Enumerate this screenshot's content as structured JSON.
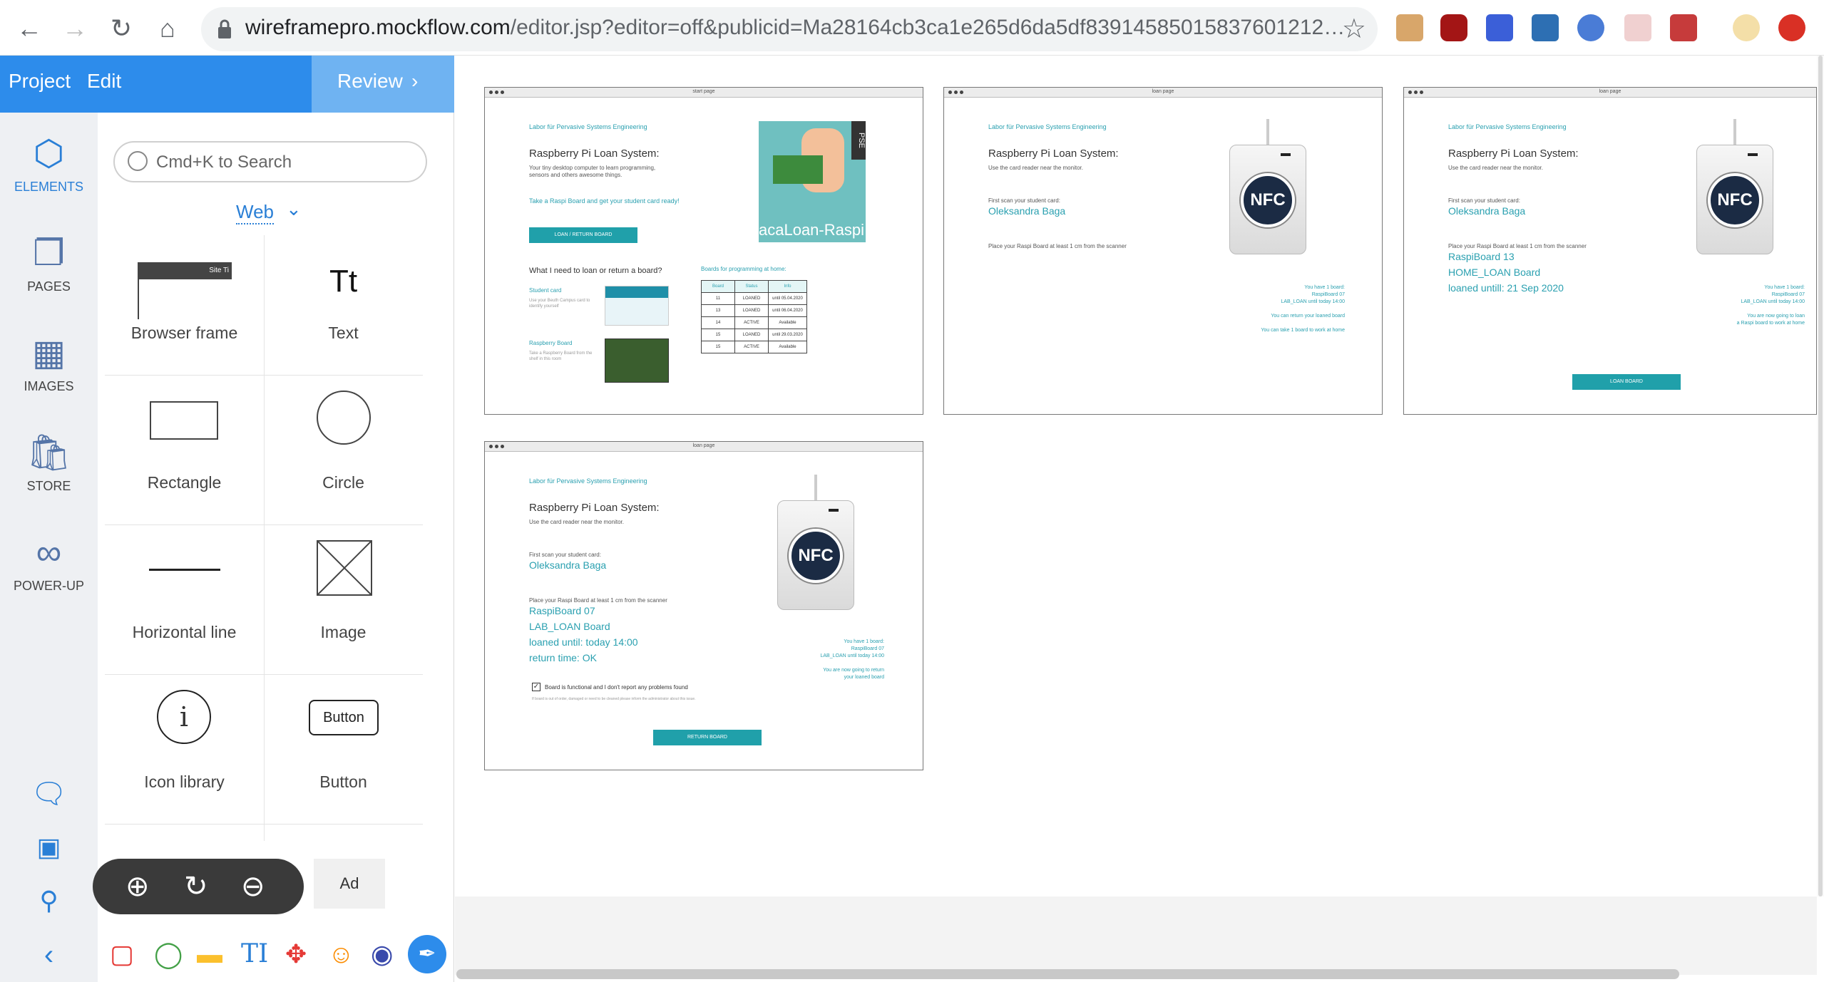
{
  "browser": {
    "url_host": "wireframepro.mockflow.com",
    "url_path": "/editor.jsp?editor=off&publicid=Ma28164cb3ca1e265d6da5df83914585015837601212…",
    "icons": [
      "back-icon",
      "forward-icon",
      "reload-icon",
      "home-icon",
      "lock-icon",
      "star-icon"
    ],
    "extension_colors": [
      "#c0392b",
      "#a31515",
      "#2e6fd8",
      "#2d6fb3",
      "#4a7cd6",
      "#d63b3b",
      "#c63b3b"
    ]
  },
  "app": {
    "menu": [
      "Project",
      "Edit"
    ],
    "review_label": "Review",
    "accent": "#2d8ceb",
    "rail": [
      {
        "label": "ELEMENTS",
        "icon": "cube-icon"
      },
      {
        "label": "PAGES",
        "icon": "pages-icon"
      },
      {
        "label": "IMAGES",
        "icon": "images-icon"
      },
      {
        "label": "STORE",
        "icon": "bag-icon"
      },
      {
        "label": "POWER-UP",
        "icon": "infinity-icon"
      }
    ],
    "search_placeholder": "Cmd+K to Search",
    "category": "Web",
    "elements": [
      {
        "label": "Browser frame",
        "thumb_text": "Site Ti"
      },
      {
        "label": "Text",
        "thumb_text": "Tt"
      },
      {
        "label": "Rectangle"
      },
      {
        "label": "Circle"
      },
      {
        "label": "Horizontal line"
      },
      {
        "label": "Image"
      },
      {
        "label": "Icon library",
        "thumb_text": "i"
      },
      {
        "label": "Button",
        "thumb_text": "Button"
      }
    ],
    "ad_label": "Ad"
  },
  "frames": [
    {
      "title": "start page",
      "lab": "Labor für Pervasive Systems Engineering",
      "heading": "Raspberry Pi Loan System:",
      "desc": "Your tiny desktop computer to learn programming, sensors and others awesome things.",
      "cta": "Take a Raspi Board and get your student card ready!",
      "button": "LOAN / RETURN BOARD",
      "question": "What I need to loan or return a board?",
      "card_label": "Student card",
      "card_desc": "Use your Beuth Campus card to identify yourself",
      "board_label": "Raspberry Board",
      "board_desc": "Take a Raspberry Board from the shelf in this room",
      "logo_side": "PSE",
      "logo_text": "acaLoan-Raspi",
      "table_title": "Boards for programming at home:",
      "table_headers": [
        "Board",
        "Status",
        "Info"
      ],
      "table_rows": [
        [
          "11",
          "LOANED",
          "until 05.04.2020"
        ],
        [
          "13",
          "LOANED",
          "until 06.04.2020"
        ],
        [
          "14",
          "ACTIVE",
          "Available"
        ],
        [
          "15",
          "LOANED",
          "until 29.03.2020"
        ],
        [
          "15",
          "ACTIVE",
          "Available"
        ]
      ]
    },
    {
      "title": "loan page",
      "lab": "Labor für Pervasive Systems Engineering",
      "heading": "Raspberry Pi Loan System:",
      "sub": "Use the card reader near the monitor.",
      "scan_label": "First scan your student card:",
      "student": "Oleksandra Baga",
      "place": "Place your Raspi Board at least 1 cm from the scanner",
      "right": [
        "You have 1 board:",
        "RaspiBoard 07",
        "LAB_LOAN until today 14:00",
        "",
        "You can return your loaned board",
        "",
        "You can take 1 board to work at home"
      ]
    },
    {
      "title": "loan page",
      "lab": "Labor für Pervasive Systems Engineering",
      "heading": "Raspberry Pi Loan System:",
      "sub": "Use the card reader near the monitor.",
      "scan_label": "First scan your student card:",
      "student": "Oleksandra Baga",
      "place": "Place your Raspi Board at least 1 cm from the scanner",
      "board": [
        "RaspiBoard 13",
        "HOME_LOAN Board",
        "loaned untill: 21 Sep 2020"
      ],
      "right": [
        "You have 1 board:",
        "RaspiBoard 07",
        "LAB_LOAN until today 14:00",
        "",
        "You are now going to loan",
        "a Raspi board to work at home"
      ],
      "button": "LOAN BOARD"
    },
    {
      "title": "loan page",
      "lab": "Labor für Pervasive Systems Engineering",
      "heading": "Raspberry Pi Loan System:",
      "sub": "Use the card reader near the monitor.",
      "scan_label": "First scan your student card:",
      "student": "Oleksandra Baga",
      "place": "Place your Raspi Board at least 1 cm from the scanner",
      "board": [
        "RaspiBoard 07",
        "LAB_LOAN Board",
        "loaned until: today 14:00",
        "return time: OK"
      ],
      "right": [
        "You have 1 board:",
        "RaspiBoard 07",
        "LAB_LOAN until today 14:00",
        "",
        "You are now going to return",
        "your loaned board"
      ],
      "check": "Board is functional and I don't report any problems found",
      "note": "If board is out of order, damaged or need to be cleaned please inform the administrator about this issue.",
      "button": "RETURN BOARD"
    }
  ]
}
